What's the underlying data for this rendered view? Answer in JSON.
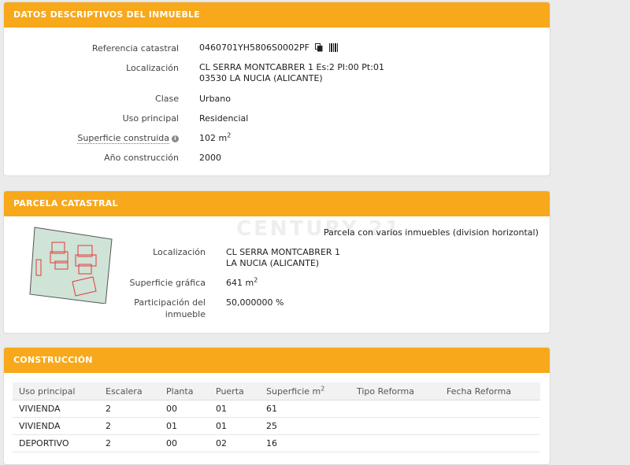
{
  "datos": {
    "header": "DATOS DESCRIPTIVOS DEL INMUEBLE",
    "referencia_label": "Referencia catastral",
    "referencia_value": "0460701YH5806S0002PF",
    "localizacion_label": "Localización",
    "localizacion_line1": "CL SERRA MONTCABRER 1 Es:2 Pl:00 Pt:01",
    "localizacion_line2": "03530 LA NUCIA (ALICANTE)",
    "clase_label": "Clase",
    "clase_value": "Urbano",
    "uso_label": "Uso principal",
    "uso_value": "Residencial",
    "superficie_label": "Superficie construida",
    "superficie_value": "102 m",
    "superficie_sup": "2",
    "anio_label": "Año construcción",
    "anio_value": "2000"
  },
  "parcela": {
    "header": "PARCELA CATASTRAL",
    "tipo": "Parcela con varios inmuebles (division horizontal)",
    "localizacion_label": "Localización",
    "localizacion_line1": "CL SERRA MONTCABRER 1",
    "localizacion_line2": "LA NUCIA (ALICANTE)",
    "superficie_label": "Superficie gráfica",
    "superficie_value": "641 m",
    "superficie_sup": "2",
    "participacion_label_line1": "Participación del",
    "participacion_label_line2": "inmueble",
    "participacion_value": "50,000000 %"
  },
  "watermark": "CENTURY 21",
  "construccion": {
    "header": "CONSTRUCCIÓN",
    "columns": [
      "Uso principal",
      "Escalera",
      "Planta",
      "Puerta",
      "Superficie m",
      "Tipo Reforma",
      "Fecha Reforma"
    ],
    "superficie_sup": "2",
    "rows": [
      [
        "VIVIENDA",
        "2",
        "00",
        "01",
        "61",
        "",
        ""
      ],
      [
        "VIVIENDA",
        "2",
        "01",
        "01",
        "25",
        "",
        ""
      ],
      [
        "DEPORTIVO",
        "2",
        "00",
        "02",
        "16",
        "",
        ""
      ]
    ]
  },
  "colors": {
    "accent": "#f7a81b",
    "parcel_fill": "#cfe3d6",
    "building_outline": "#e23b3b"
  },
  "icons": {
    "copy": "copy-icon",
    "barcode": "barcode-icon",
    "info": "info-icon"
  }
}
